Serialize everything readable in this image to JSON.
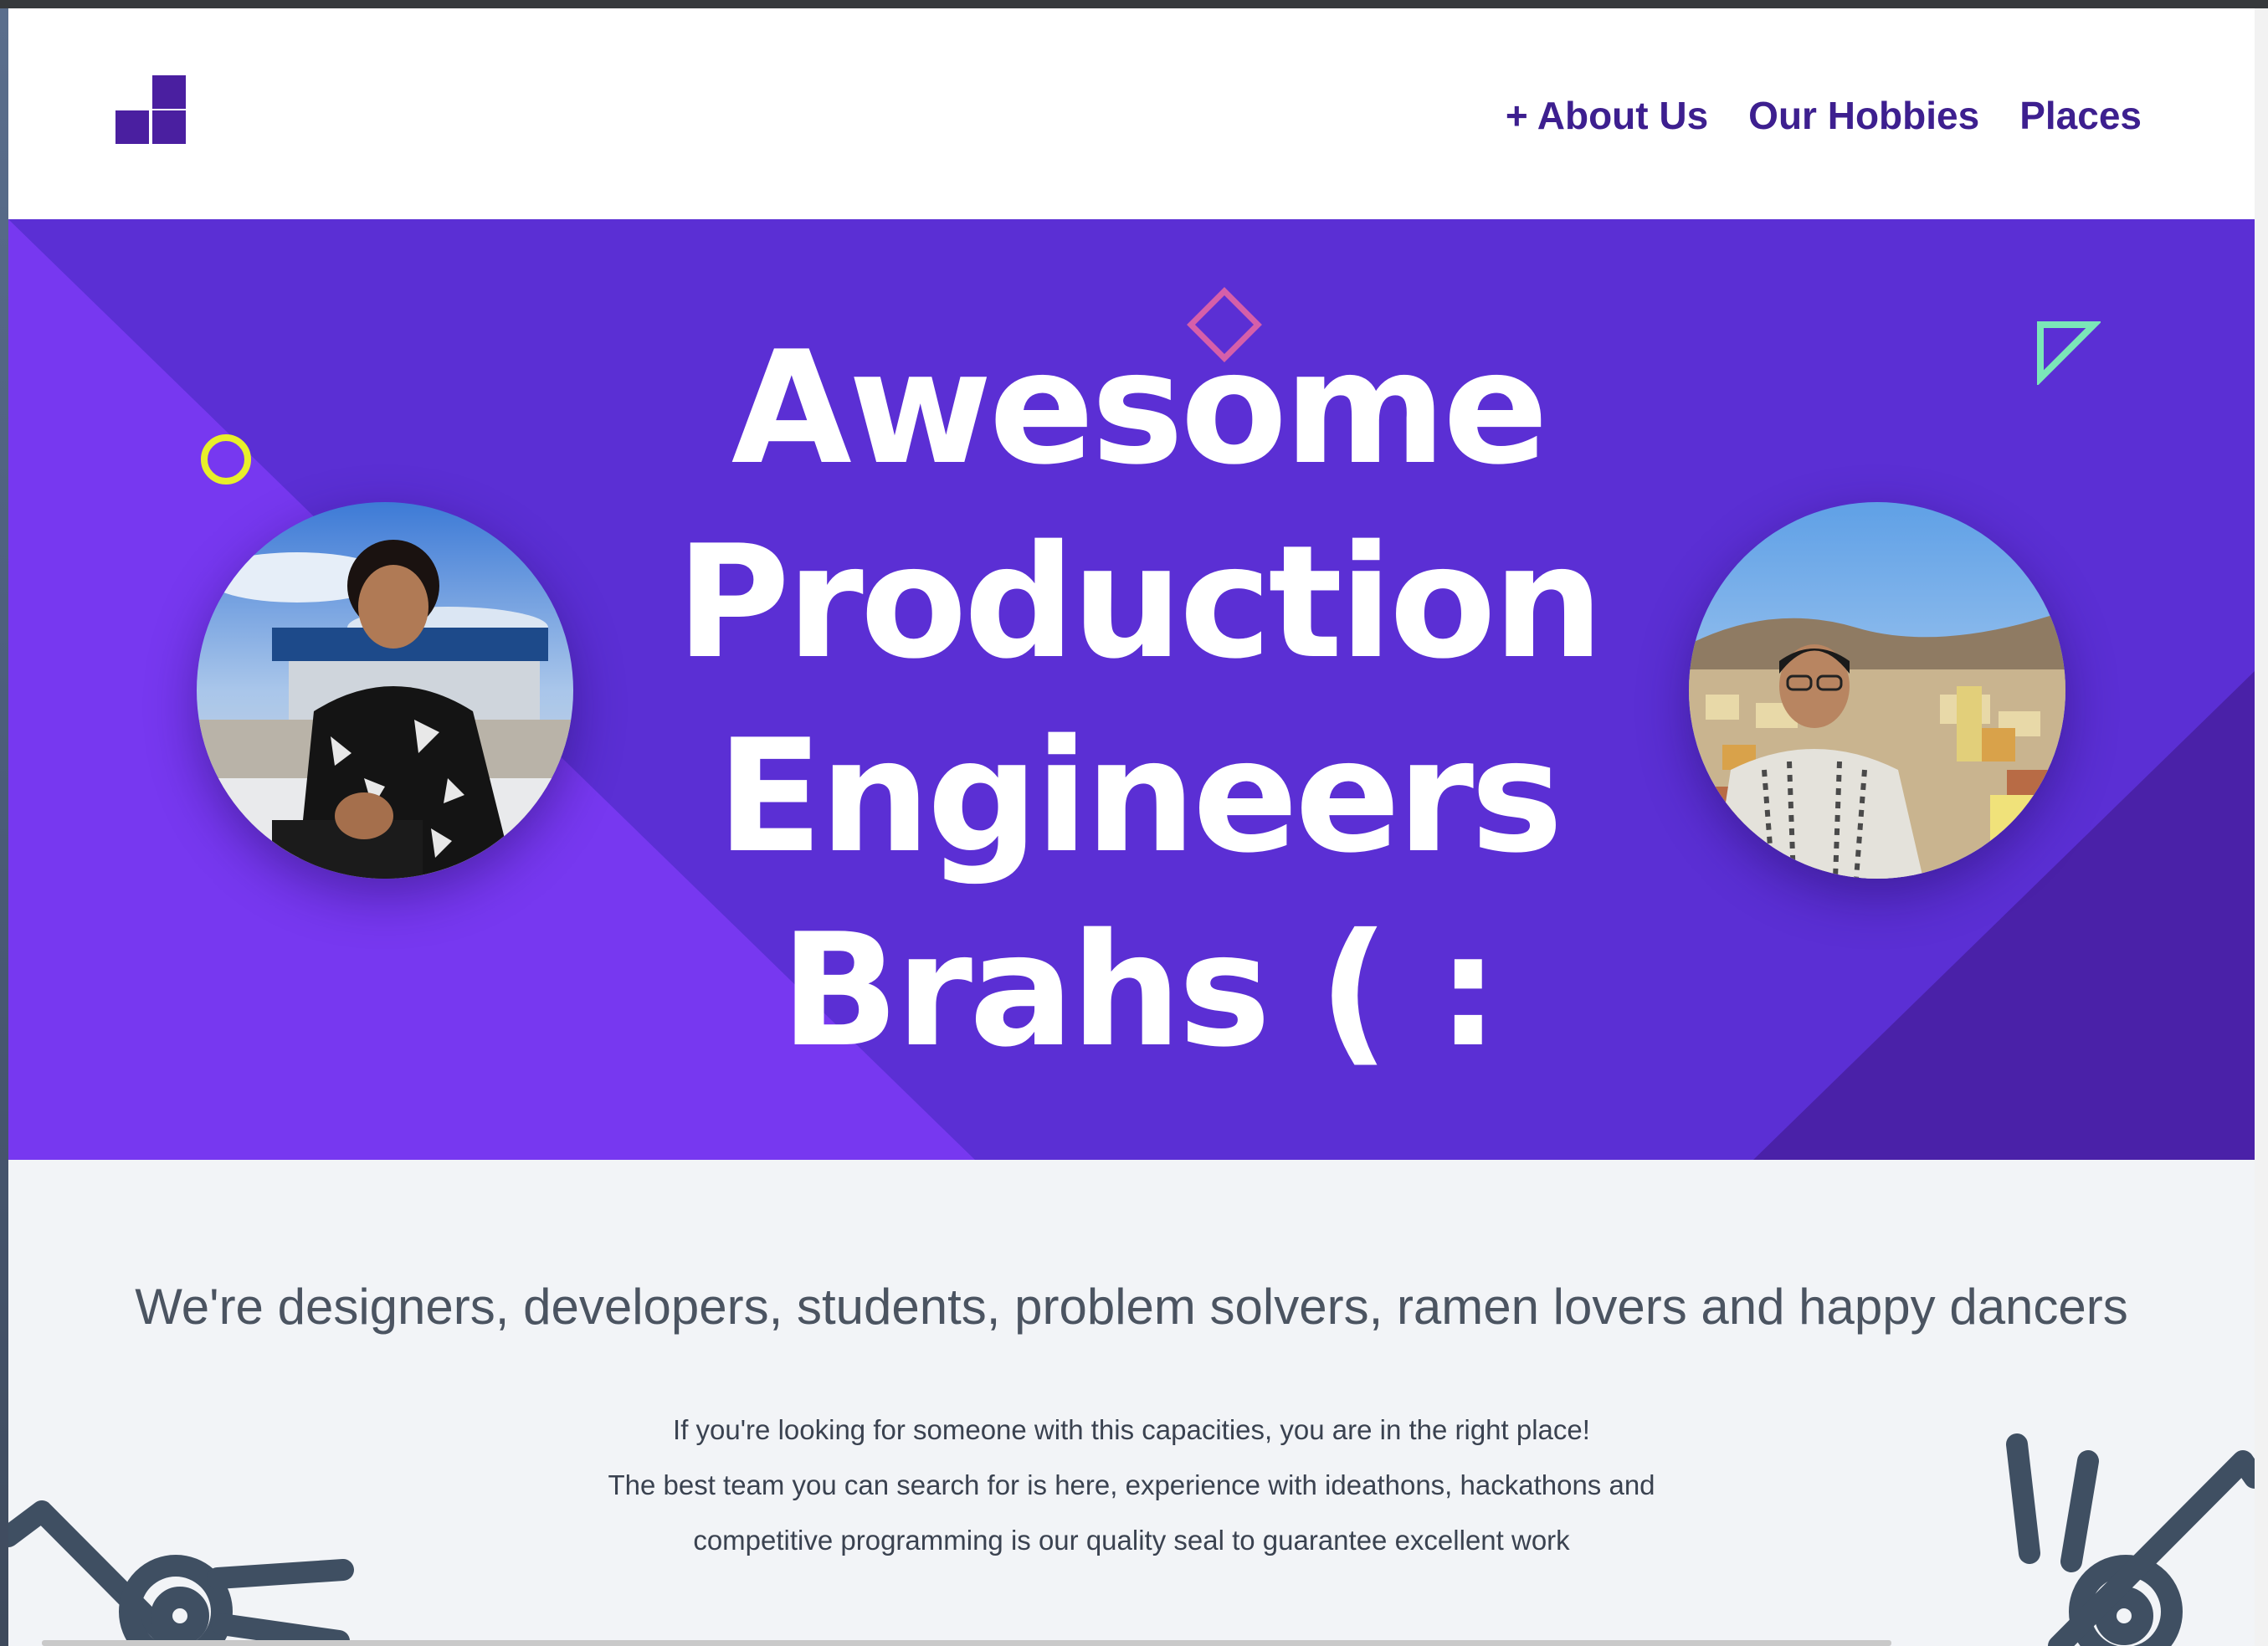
{
  "header": {
    "logo_icon": "blocks-logo-icon",
    "nav": [
      {
        "label": "+ About Us"
      },
      {
        "label": "Our Hobbies"
      },
      {
        "label": "Places"
      }
    ]
  },
  "hero": {
    "headline_lines": [
      "Awesome",
      "Production",
      "Engineers",
      "Brahs ( :"
    ],
    "colors": {
      "background": "#5b2fd4",
      "light_band": "#7738f0",
      "dark_band": "#4a21a8",
      "circle_accent": "#e8ef2a",
      "diamond_accent": "#d65fa9",
      "triangle_accent": "#7be6b8"
    }
  },
  "about": {
    "tagline": "We're designers, developers, students, problem solvers, ramen lovers and happy dancers",
    "description_lines": [
      "If you're looking for someone with this capacities, you are in the right place!",
      "The best team you can search for is here, experience with ideathons, hackathons and",
      "competitive programming is our quality seal to guarantee excellent work"
    ]
  }
}
